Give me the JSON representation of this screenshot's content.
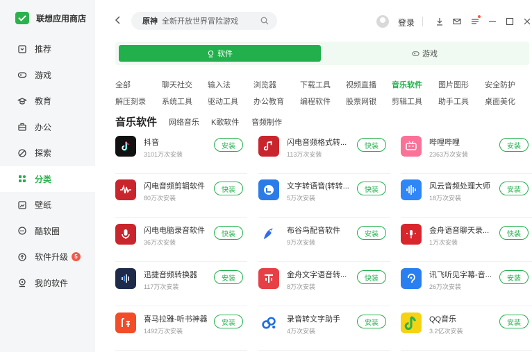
{
  "sidebar": {
    "brand": "联想应用商店",
    "items": [
      {
        "label": "推荐",
        "icon": "recommend-icon"
      },
      {
        "label": "游戏",
        "icon": "gamepad-icon"
      },
      {
        "label": "教育",
        "icon": "graduation-cap-icon"
      },
      {
        "label": "办公",
        "icon": "briefcase-icon"
      },
      {
        "label": "探索",
        "icon": "compass-icon"
      },
      {
        "label": "分类",
        "icon": "category-icon"
      },
      {
        "label": "壁纸",
        "icon": "wallpaper-icon"
      },
      {
        "label": "酷软圈",
        "icon": "chat-circle-icon"
      },
      {
        "label": "软件升级",
        "icon": "upgrade-icon",
        "badge": "5"
      },
      {
        "label": "我的软件",
        "icon": "my-software-icon"
      }
    ],
    "active_index": 5
  },
  "search": {
    "hot": "原神",
    "placeholder": "全新开放世界冒险游戏"
  },
  "header": {
    "login": "登录"
  },
  "type_tabs": {
    "software": "软件",
    "games": "游戏"
  },
  "categories_row1": [
    "全部",
    "聊天社交",
    "输入法",
    "浏览器",
    "下载工具",
    "视频直播",
    "音乐软件",
    "图片图形",
    "安全防护"
  ],
  "categories_row2": [
    "解压刻录",
    "系统工具",
    "驱动工具",
    "办公教育",
    "编程软件",
    "股票网银",
    "剪辑工具",
    "助手工具",
    "桌面美化"
  ],
  "active_category": "音乐软件",
  "section": {
    "title": "音乐软件",
    "subtabs": [
      "网络音乐",
      "K歌软件",
      "音频制作"
    ]
  },
  "apps": [
    {
      "name": "抖音",
      "installs": "3101万次安装",
      "button": "安装",
      "color": "#111111",
      "icon": "douyin-icon"
    },
    {
      "name": "闪电音频格式转...",
      "installs": "113万次安装",
      "button": "快装",
      "color": "#c9252c",
      "icon": "music-note-icon"
    },
    {
      "name": "哔哩哔哩",
      "installs": "2363万次安装",
      "button": "安装",
      "color": "#fb7299",
      "icon": "bilibili-icon"
    },
    {
      "name": "闪电音频剪辑软件",
      "installs": "80万次安装",
      "button": "快装",
      "color": "#c9252c",
      "icon": "waveform-icon"
    },
    {
      "name": "文字转语音(转转...",
      "installs": "5万次安装",
      "button": "快装",
      "color": "#2b7ce9",
      "icon": "text-speech-icon"
    },
    {
      "name": "风云音频处理大师",
      "installs": "18万次安装",
      "button": "安装",
      "color": "#2f86f6",
      "icon": "audio-bars-icon"
    },
    {
      "name": "闪电电脑录音软件",
      "installs": "36万次安装",
      "button": "快装",
      "color": "#c9252c",
      "icon": "microphone-icon"
    },
    {
      "name": "布谷鸟配音软件",
      "installs": "9万次安装",
      "button": "安装",
      "color": "#ffffff",
      "icon": "cuckoo-icon"
    },
    {
      "name": "金舟语音聊天录...",
      "installs": "1万次安装",
      "button": "快装",
      "color": "#d8262c",
      "icon": "mic-chat-icon"
    },
    {
      "name": "迅捷音频转换器",
      "installs": "117万次安装",
      "button": "安装",
      "color": "#1d2a4a",
      "icon": "audio-wave-icon"
    },
    {
      "name": "金舟文字语音转...",
      "installs": "8万次安装",
      "button": "快装",
      "color": "#e63f45",
      "icon": "text-audio-icon"
    },
    {
      "name": "讯飞听见字幕-音...",
      "installs": "26万次安装",
      "button": "安装",
      "color": "#2a7ff0",
      "icon": "ear-icon"
    },
    {
      "name": "喜马拉雅-听书神器",
      "installs": "1492万次安装",
      "button": "安装",
      "color": "#f24c29",
      "icon": "ximalaya-icon"
    },
    {
      "name": "录音转文字助手",
      "installs": "4万次安装",
      "button": "安装",
      "color": "#ffffff",
      "icon": "record-text-icon"
    },
    {
      "name": "QQ音乐",
      "installs": "3.2亿次安装",
      "button": "安装",
      "color": "#f5d313",
      "icon": "qqmusic-icon"
    }
  ],
  "colors": {
    "accent": "#21b04b",
    "badge": "#f0584b"
  }
}
